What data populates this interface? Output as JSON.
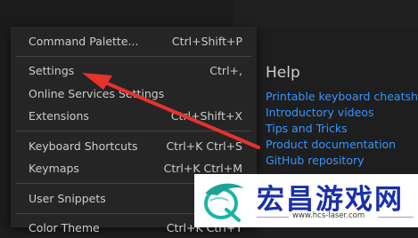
{
  "menu": {
    "items": [
      {
        "label": "Command Palette...",
        "shortcut": "Ctrl+Shift+P"
      },
      {
        "label": "Settings",
        "shortcut": "Ctrl+,"
      },
      {
        "label": "Online Services Settings",
        "shortcut": ""
      },
      {
        "label": "Extensions",
        "shortcut": "Ctrl+Shift+X"
      },
      {
        "label": "Keyboard Shortcuts",
        "shortcut": "Ctrl+K Ctrl+S"
      },
      {
        "label": "Keymaps",
        "shortcut": "Ctrl+K Ctrl+M"
      },
      {
        "label": "User Snippets",
        "shortcut": ""
      },
      {
        "label": "Color Theme",
        "shortcut": "Ctrl+K Ctrl+T"
      }
    ]
  },
  "help": {
    "title": "Help",
    "links": [
      "Printable keyboard cheatsheet",
      "Introductory videos",
      "Tips and Tricks",
      "Product documentation",
      "GitHub repository"
    ]
  },
  "watermark": {
    "name": "宏昌游戏网",
    "url": "www.hcs-laser.com"
  },
  "colors": {
    "menu_bg": "#252526",
    "link": "#3794ff",
    "arrow": "#e8322d",
    "watermark_text": "#1a2fa8"
  }
}
